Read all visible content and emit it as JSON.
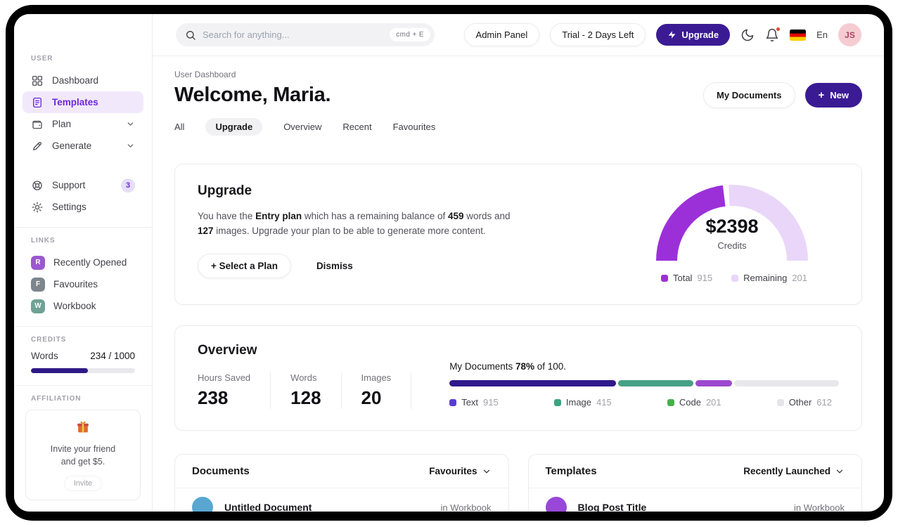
{
  "colors": {
    "primary": "#3b1b94",
    "credits_fill": "#2e1a87",
    "gauge_total": "#9b30d9",
    "gauge_remaining": "#e9d6f8"
  },
  "topbar": {
    "search_placeholder": "Search for anything...",
    "shortcut": "cmd + E",
    "admin_panel": "Admin Panel",
    "trial": "Trial - 2 Days Left",
    "upgrade": "Upgrade",
    "language": "En",
    "avatar": "JS"
  },
  "sidebar": {
    "section_user": "USER",
    "items": [
      {
        "label": "Dashboard"
      },
      {
        "label": "Templates"
      },
      {
        "label": "Plan"
      },
      {
        "label": "Generate"
      }
    ],
    "support_label": "Support",
    "support_badge": "3",
    "settings_label": "Settings",
    "section_links": "LINKS",
    "links": [
      {
        "initial": "R",
        "label": "Recently Opened",
        "color": "#9b59d0"
      },
      {
        "initial": "F",
        "label": "Favourites",
        "color": "#7d858d"
      },
      {
        "initial": "W",
        "label": "Workbook",
        "color": "#6fa294"
      }
    ],
    "section_credits": "CREDITS",
    "credits": {
      "label": "Words",
      "value": "234 / 1000",
      "fill_percent": 55
    },
    "section_affiliation": "AFFILIATION",
    "affiliation": {
      "line1": "Invite your friend",
      "line2": "and get $5.",
      "button": "Invite"
    }
  },
  "header": {
    "breadcrumb": "User Dashboard",
    "title": "Welcome, Maria.",
    "my_documents": "My Documents",
    "new": "New",
    "tabs": [
      "All",
      "Upgrade",
      "Overview",
      "Recent",
      "Favourites"
    ],
    "active_tab": "Upgrade"
  },
  "upgrade_card": {
    "title": "Upgrade",
    "body": {
      "p1": "You have the ",
      "b1": "Entry plan",
      "p2": " which has a remaining balance of ",
      "b2": "459",
      "p3": " words and ",
      "b3": "127",
      "p4": " images. Upgrade your plan to be able to generate more content."
    },
    "select_plan": "Select a Plan",
    "dismiss": "Dismiss",
    "gauge": {
      "value": "$2398",
      "label": "Credits",
      "legend": [
        {
          "label": "Total",
          "value": "915",
          "color": "#9b30d9"
        },
        {
          "label": "Remaining",
          "value": "201",
          "color": "#e9d6f8"
        }
      ]
    }
  },
  "overview_card": {
    "title": "Overview",
    "stats": [
      {
        "label": "Hours Saved",
        "value": "238"
      },
      {
        "label": "Words",
        "value": "128"
      },
      {
        "label": "Images",
        "value": "20"
      }
    ],
    "progress": {
      "prefix": "My Documents ",
      "percent": "78%",
      "suffix": " of 100."
    },
    "bar_segments": [
      {
        "color": "#2f1a8c",
        "width": 42.7
      },
      {
        "color": "#46a184",
        "width": 19.4
      },
      {
        "color": "#9d49cf",
        "width": 9.4
      },
      {
        "color": "#e8e8ec",
        "width": 28.5
      }
    ],
    "legend": [
      {
        "label": "Text",
        "value": "915",
        "color": "#5a3bd7"
      },
      {
        "label": "Image",
        "value": "415",
        "color": "#3da380"
      },
      {
        "label": "Code",
        "value": "201",
        "color": "#47b04b"
      },
      {
        "label": "Other",
        "value": "612",
        "color": "#e5e5e9"
      }
    ]
  },
  "documents_card": {
    "title": "Documents",
    "filter": "Favourites",
    "rows": [
      {
        "title": "Untitled Document",
        "location": "in Workbook",
        "color": "#59a7d1"
      }
    ]
  },
  "templates_card": {
    "title": "Templates",
    "filter": "Recently Launched",
    "rows": [
      {
        "title": "Blog Post Title",
        "location": "in Workbook",
        "color": "#9847d9"
      }
    ]
  }
}
